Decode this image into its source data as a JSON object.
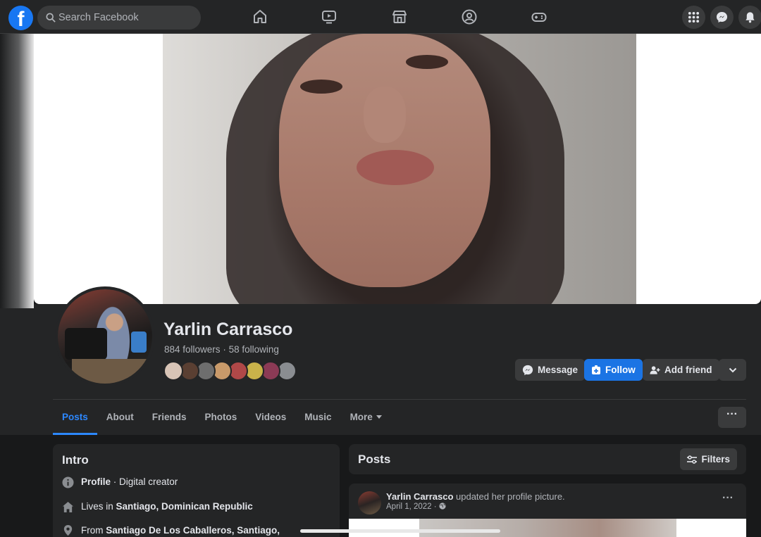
{
  "topbar": {
    "logo_letter": "f",
    "search_placeholder": "Search Facebook",
    "nav_icons": [
      "home-icon",
      "watch-icon",
      "marketplace-icon",
      "groups-icon",
      "gaming-icon"
    ],
    "right_icons": [
      "menu-grid-icon",
      "messenger-icon",
      "notifications-icon"
    ]
  },
  "profile": {
    "name": "Yarlin Carrasco",
    "followers": "884 followers",
    "separator": "·",
    "following": "58 following",
    "friend_avatar_colors": [
      "#d8c4b6",
      "#5a3f32",
      "#6e6e6e",
      "#c99a6a",
      "#b04848",
      "#c9b24a",
      "#8b3a55",
      "#8a8d91"
    ]
  },
  "actions": {
    "message": "Message",
    "follow": "Follow",
    "add_friend": "Add friend"
  },
  "tabs": {
    "items": [
      "Posts",
      "About",
      "Friends",
      "Photos",
      "Videos",
      "Music",
      "More"
    ],
    "active": "Posts",
    "menu": "···"
  },
  "intro": {
    "title": "Intro",
    "profile_label": "Profile",
    "profile_value": " · Digital creator",
    "lives_prefix": "Lives in ",
    "lives_value": "Santiago, Dominican Republic",
    "from_prefix": "From ",
    "from_value": "Santiago De Los Caballeros, Santiago, Dominican Republic"
  },
  "posts": {
    "title": "Posts",
    "filters": "Filters",
    "post": {
      "author": "Yarlin Carrasco",
      "action": " updated her profile picture.",
      "date": "April 1, 2022",
      "dot": "·",
      "menu": "···"
    }
  },
  "colors": {
    "accent": "#1b74e4",
    "active_tab": "#2d88ff",
    "surface": "#242526",
    "background": "#18191a"
  }
}
